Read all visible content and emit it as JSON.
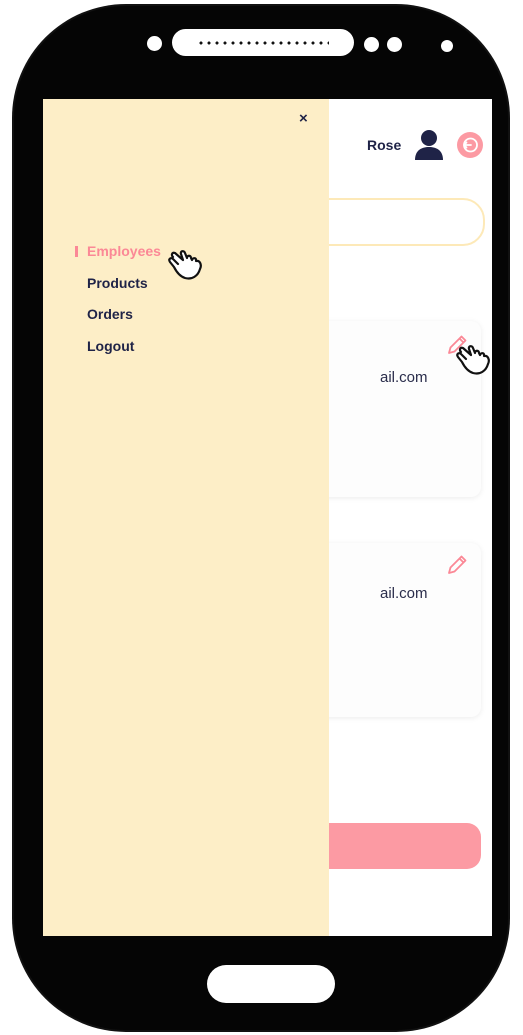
{
  "header": {
    "user_name": "Rose",
    "user_icon": "user-icon",
    "logout_icon": "logout-icon"
  },
  "drawer": {
    "close_label": "×",
    "menu": [
      {
        "label": "Employees",
        "active": true
      },
      {
        "label": "Products",
        "active": false
      },
      {
        "label": "Orders",
        "active": false
      },
      {
        "label": "Logout",
        "active": false
      }
    ]
  },
  "cards": [
    {
      "email_fragment": "ail.com",
      "edit_icon": "pencil-icon"
    },
    {
      "email_fragment": "ail.com",
      "edit_icon": "pencil-icon"
    }
  ],
  "colors": {
    "drawer_bg": "#fdeec7",
    "accent": "#fb8896",
    "text_dark": "#1f2347",
    "button_pink": "#fc9aa3",
    "phone_frame": "#050505"
  }
}
